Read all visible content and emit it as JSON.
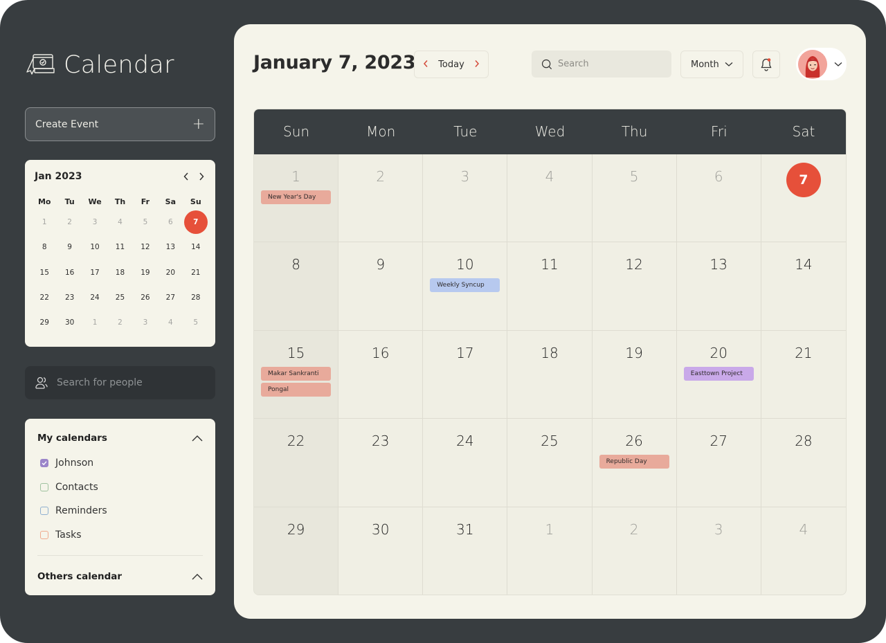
{
  "app": {
    "title": "Calendar",
    "create_event_label": "Create Event",
    "create_event_icon": "plus-icon"
  },
  "mini_calendar": {
    "title": "Jan 2023",
    "weekdays": [
      "Mo",
      "Tu",
      "We",
      "Th",
      "Fr",
      "Sa",
      "Su"
    ],
    "days": [
      {
        "n": "1",
        "muted": true
      },
      {
        "n": "2",
        "muted": true
      },
      {
        "n": "3",
        "muted": true
      },
      {
        "n": "4",
        "muted": true
      },
      {
        "n": "5",
        "muted": true
      },
      {
        "n": "6",
        "muted": true
      },
      {
        "n": "7",
        "selected": true
      },
      {
        "n": "8"
      },
      {
        "n": "9"
      },
      {
        "n": "10"
      },
      {
        "n": "11"
      },
      {
        "n": "12"
      },
      {
        "n": "13"
      },
      {
        "n": "14"
      },
      {
        "n": "15"
      },
      {
        "n": "16"
      },
      {
        "n": "17"
      },
      {
        "n": "18"
      },
      {
        "n": "19"
      },
      {
        "n": "20"
      },
      {
        "n": "21"
      },
      {
        "n": "22"
      },
      {
        "n": "23"
      },
      {
        "n": "24"
      },
      {
        "n": "25"
      },
      {
        "n": "26"
      },
      {
        "n": "27"
      },
      {
        "n": "28"
      },
      {
        "n": "29"
      },
      {
        "n": "30"
      },
      {
        "n": "1",
        "muted": true
      },
      {
        "n": "2",
        "muted": true
      },
      {
        "n": "3",
        "muted": true
      },
      {
        "n": "4",
        "muted": true
      },
      {
        "n": "5",
        "muted": true
      }
    ]
  },
  "people_search": {
    "placeholder": "Search for people"
  },
  "my_calendars": {
    "title": "My calendars",
    "items": [
      {
        "label": "Johnson",
        "checked": true,
        "color": "#9b85c9"
      },
      {
        "label": "Contacts",
        "checked": false,
        "color": "#9fc29f"
      },
      {
        "label": "Reminders",
        "checked": false,
        "color": "#8fb0d0"
      },
      {
        "label": "Tasks",
        "checked": false,
        "color": "#efab8e"
      }
    ]
  },
  "others_calendar": {
    "title": "Others calendar"
  },
  "header": {
    "date_title": "January 7, 2023",
    "today_label": "Today",
    "search_placeholder": "Search",
    "view_selected": "Month",
    "notification_dot": true
  },
  "colors": {
    "accent": "#e6503a",
    "holiday": "#e8aa9b",
    "meeting": "#b7c9ef",
    "project": "#c9a9e9"
  },
  "month_grid": {
    "weekdays": [
      "Sun",
      "Mon",
      "Tue",
      "Wed",
      "Thu",
      "Fri",
      "Sat"
    ],
    "cells": [
      {
        "n": "1",
        "other": true,
        "events": [
          {
            "label": "New Year's Day",
            "kind": "holiday"
          }
        ]
      },
      {
        "n": "2",
        "other": true,
        "events": []
      },
      {
        "n": "3",
        "other": true,
        "events": []
      },
      {
        "n": "4",
        "other": true,
        "events": []
      },
      {
        "n": "5",
        "other": true,
        "events": []
      },
      {
        "n": "6",
        "other": true,
        "events": []
      },
      {
        "n": "7",
        "today": true,
        "events": []
      },
      {
        "n": "8",
        "events": []
      },
      {
        "n": "9",
        "events": []
      },
      {
        "n": "10",
        "events": [
          {
            "label": "Weekly Syncup",
            "kind": "meeting"
          }
        ]
      },
      {
        "n": "11",
        "events": []
      },
      {
        "n": "12",
        "events": []
      },
      {
        "n": "13",
        "events": []
      },
      {
        "n": "14",
        "events": []
      },
      {
        "n": "15",
        "events": [
          {
            "label": "Makar Sankranti",
            "kind": "holiday"
          },
          {
            "label": "Pongal",
            "kind": "holiday"
          }
        ]
      },
      {
        "n": "16",
        "events": []
      },
      {
        "n": "17",
        "events": []
      },
      {
        "n": "18",
        "events": []
      },
      {
        "n": "19",
        "events": []
      },
      {
        "n": "20",
        "events": [
          {
            "label": "Easttown Project",
            "kind": "project"
          }
        ]
      },
      {
        "n": "21",
        "events": []
      },
      {
        "n": "22",
        "events": []
      },
      {
        "n": "23",
        "events": []
      },
      {
        "n": "24",
        "events": []
      },
      {
        "n": "25",
        "events": []
      },
      {
        "n": "26",
        "events": [
          {
            "label": "Republic Day",
            "kind": "holiday"
          }
        ]
      },
      {
        "n": "27",
        "events": []
      },
      {
        "n": "28",
        "events": []
      },
      {
        "n": "29",
        "events": []
      },
      {
        "n": "30",
        "events": []
      },
      {
        "n": "31",
        "events": []
      },
      {
        "n": "1",
        "other": true,
        "events": []
      },
      {
        "n": "2",
        "other": true,
        "events": []
      },
      {
        "n": "3",
        "other": true,
        "events": []
      },
      {
        "n": "4",
        "other": true,
        "events": []
      }
    ]
  }
}
